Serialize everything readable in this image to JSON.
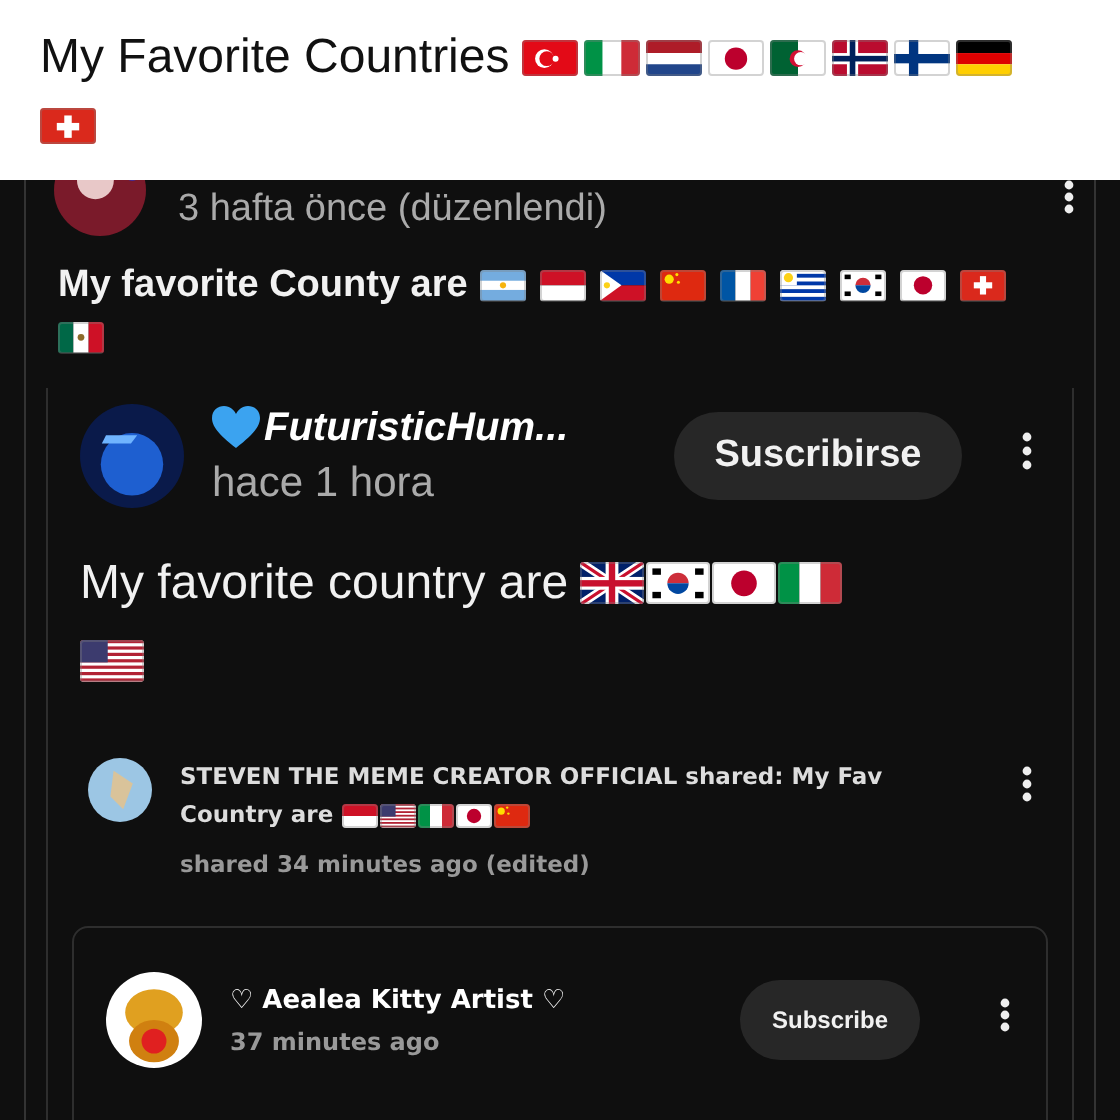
{
  "header": {
    "title": "My Favorite Countries"
  },
  "post": {
    "time": "3 hafta önce (düzenlendi)",
    "text": "My favorite County are"
  },
  "shared_post": {
    "author": "FuturisticHum...",
    "time": "hace 1 hora",
    "subscribe": "Suscribirse",
    "text": "My favorite country are"
  },
  "share": {
    "text_lines": [
      "STEVEN THE MEME CREATOR OFFICIAL shared: My Fav",
      "Country are"
    ],
    "time": "shared 34 minutes ago (edited)"
  },
  "nested_post": {
    "author": "♡ Aealea Kitty Artist ♡",
    "time": "37 minutes ago",
    "subscribe": "Subscribe"
  }
}
